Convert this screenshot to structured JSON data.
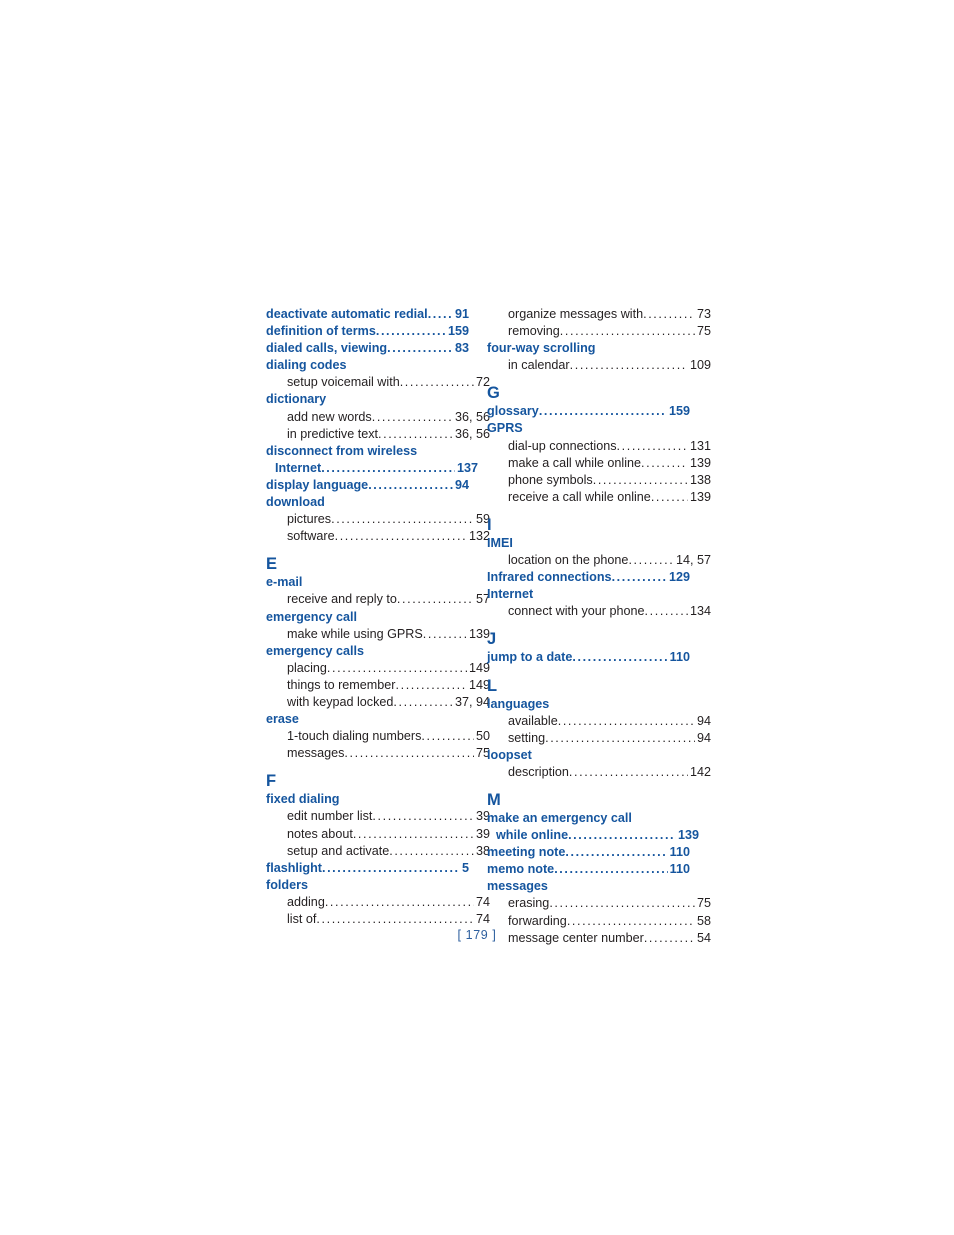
{
  "document": {
    "type": "index",
    "folio": "[ 179 ]",
    "colors": {
      "heading_blue": "#15559e",
      "body_text": "#231f20",
      "folio_blue": "#2d5f9e",
      "page_background": "#ffffff"
    }
  },
  "columns": [
    {
      "name": "left-column",
      "sections": [
        {
          "letter": "",
          "entries": [
            {
              "level": "head",
              "label": "deactivate automatic redial",
              "page": "91"
            },
            {
              "level": "head",
              "label": "definition of terms",
              "page": "159"
            },
            {
              "level": "head",
              "label": "dialed calls, viewing",
              "page": "83"
            },
            {
              "level": "head",
              "label": "dialing codes",
              "page": ""
            },
            {
              "level": "sub",
              "label": "setup voicemail with",
              "page": "72"
            },
            {
              "level": "head",
              "label": "dictionary",
              "page": ""
            },
            {
              "level": "sub",
              "label": "add new words",
              "page": "36, 56"
            },
            {
              "level": "sub",
              "label": "in predictive text",
              "page": "36, 56"
            },
            {
              "level": "head",
              "label": "disconnect from wireless",
              "page": ""
            },
            {
              "level": "head-cont",
              "label": "Internet",
              "page": "137"
            },
            {
              "level": "head",
              "label": "display language",
              "page": "94"
            },
            {
              "level": "head",
              "label": "download",
              "page": ""
            },
            {
              "level": "sub",
              "label": "pictures",
              "page": "59"
            },
            {
              "level": "sub",
              "label": "software",
              "page": "132"
            }
          ]
        },
        {
          "letter": "E",
          "entries": [
            {
              "level": "head",
              "label": "e-mail",
              "page": ""
            },
            {
              "level": "sub",
              "label": "receive and reply to",
              "page": "57"
            },
            {
              "level": "head",
              "label": "emergency call",
              "page": ""
            },
            {
              "level": "sub",
              "label": "make while using GPRS",
              "page": "139"
            },
            {
              "level": "head",
              "label": "emergency calls",
              "page": ""
            },
            {
              "level": "sub",
              "label": "placing",
              "page": "149"
            },
            {
              "level": "sub",
              "label": "things to remember",
              "page": "149"
            },
            {
              "level": "sub",
              "label": "with keypad locked",
              "page": "37, 94"
            },
            {
              "level": "head",
              "label": "erase",
              "page": ""
            },
            {
              "level": "sub",
              "label": "1-touch dialing numbers",
              "page": "50"
            },
            {
              "level": "sub",
              "label": "messages",
              "page": "75"
            }
          ]
        },
        {
          "letter": "F",
          "entries": [
            {
              "level": "head",
              "label": "fixed dialing",
              "page": ""
            },
            {
              "level": "sub",
              "label": "edit number list",
              "page": "39"
            },
            {
              "level": "sub",
              "label": "notes about",
              "page": "39"
            },
            {
              "level": "sub",
              "label": "setup and activate",
              "page": "38"
            },
            {
              "level": "head",
              "label": "flashlight",
              "page": "5"
            },
            {
              "level": "head",
              "label": "folders",
              "page": ""
            },
            {
              "level": "sub",
              "label": "adding",
              "page": "74"
            },
            {
              "level": "sub",
              "label": "list of",
              "page": "74"
            }
          ]
        }
      ]
    },
    {
      "name": "right-column",
      "sections": [
        {
          "letter": "",
          "entries": [
            {
              "level": "sub",
              "label": "organize messages with",
              "page": "73"
            },
            {
              "level": "sub",
              "label": "removing",
              "page": "75"
            },
            {
              "level": "head",
              "label": "four-way scrolling",
              "page": ""
            },
            {
              "level": "sub",
              "label": "in calendar",
              "page": "109"
            }
          ]
        },
        {
          "letter": "G",
          "entries": [
            {
              "level": "head",
              "label": "glossary",
              "page": "159"
            },
            {
              "level": "head",
              "label": "GPRS",
              "page": ""
            },
            {
              "level": "sub",
              "label": "dial-up connections",
              "page": "131"
            },
            {
              "level": "sub",
              "label": "make a call while online",
              "page": "139"
            },
            {
              "level": "sub",
              "label": "phone symbols",
              "page": "138"
            },
            {
              "level": "sub",
              "label": "receive a call while online",
              "page": "139"
            }
          ]
        },
        {
          "letter": "I",
          "entries": [
            {
              "level": "head",
              "label": "IMEI",
              "page": ""
            },
            {
              "level": "sub",
              "label": "location on the phone",
              "page": "14, 57"
            },
            {
              "level": "head",
              "label": "Infrared connections",
              "page": "129"
            },
            {
              "level": "head",
              "label": "Internet",
              "page": ""
            },
            {
              "level": "sub",
              "label": "connect with your phone",
              "page": "134"
            }
          ]
        },
        {
          "letter": "J",
          "entries": [
            {
              "level": "head",
              "label": "jump to a date",
              "page": "110"
            }
          ]
        },
        {
          "letter": "L",
          "entries": [
            {
              "level": "head",
              "label": "languages",
              "page": ""
            },
            {
              "level": "sub",
              "label": "available",
              "page": "94"
            },
            {
              "level": "sub",
              "label": "setting",
              "page": "94"
            },
            {
              "level": "head",
              "label": "loopset",
              "page": ""
            },
            {
              "level": "sub",
              "label": "description",
              "page": "142"
            }
          ]
        },
        {
          "letter": "M",
          "entries": [
            {
              "level": "head",
              "label": "make an emergency call",
              "page": ""
            },
            {
              "level": "head-cont",
              "label": "while online",
              "page": "139"
            },
            {
              "level": "head",
              "label": "meeting note",
              "page": "110"
            },
            {
              "level": "head",
              "label": "memo note",
              "page": "110"
            },
            {
              "level": "head",
              "label": "messages",
              "page": ""
            },
            {
              "level": "sub",
              "label": "erasing",
              "page": "75"
            },
            {
              "level": "sub",
              "label": "forwarding",
              "page": "58"
            },
            {
              "level": "sub",
              "label": "message center number",
              "page": "54"
            }
          ]
        }
      ]
    }
  ]
}
